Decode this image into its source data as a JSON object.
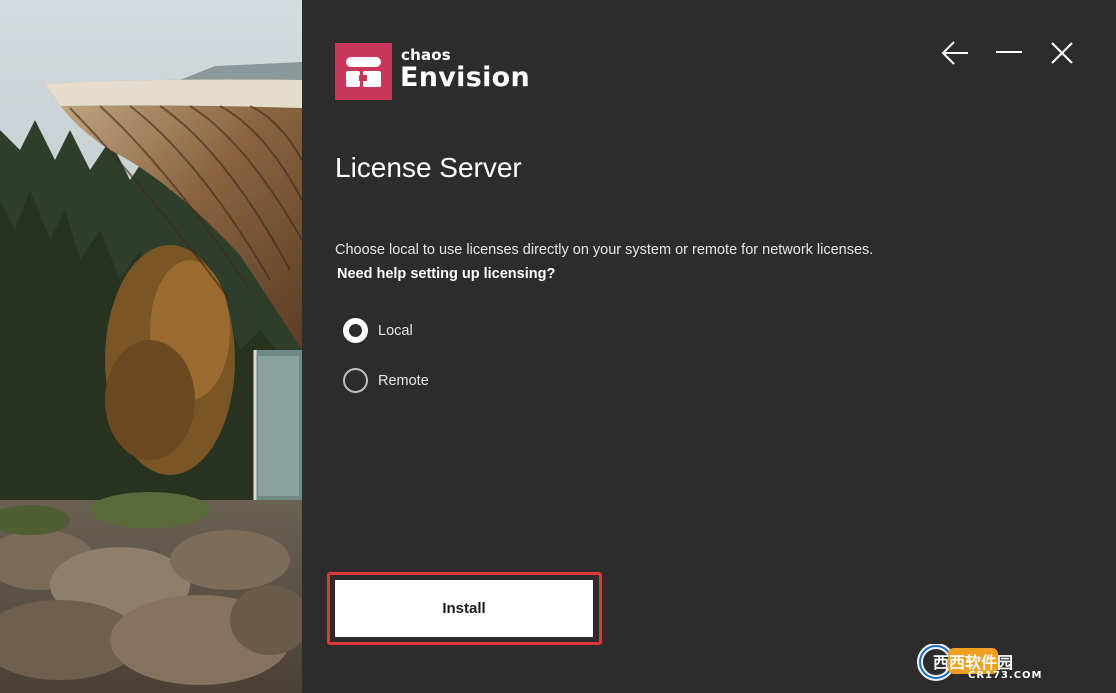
{
  "brand": {
    "company": "chaos",
    "product": "Envision",
    "logo_color": "#c8365a"
  },
  "window_controls": {
    "back_icon": "arrow-left-icon",
    "minimize_icon": "minimize-icon",
    "close_icon": "close-icon"
  },
  "page": {
    "title": "License Server",
    "description": "Choose local to use licenses directly on your system or remote for network licenses.",
    "help_link": "Need help setting up licensing?"
  },
  "license_options": [
    {
      "label": "Local",
      "selected": true
    },
    {
      "label": "Remote",
      "selected": false
    }
  ],
  "actions": {
    "install_label": "Install",
    "highlight_color": "#e0383a"
  },
  "watermark": {
    "text": "西西软件园",
    "site": "CR173.COM"
  },
  "colors": {
    "panel_bg": "#2c2c2c",
    "text": "#ffffff",
    "button_bg": "#ffffff"
  }
}
